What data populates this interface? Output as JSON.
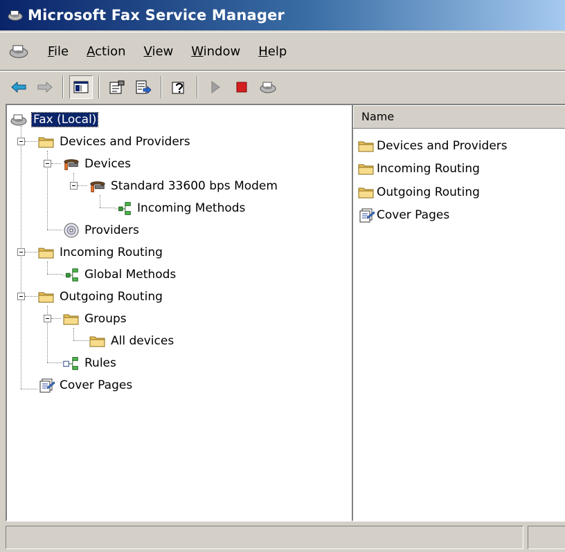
{
  "window": {
    "title": "Microsoft Fax Service Manager",
    "title_bar_colors": [
      "#0a246a",
      "#a6caf0"
    ]
  },
  "menu": {
    "items": [
      {
        "label": "File",
        "accel": "F"
      },
      {
        "label": "Action",
        "accel": "A"
      },
      {
        "label": "View",
        "accel": "V"
      },
      {
        "label": "Window",
        "accel": "W"
      },
      {
        "label": "Help",
        "accel": "H"
      }
    ]
  },
  "toolbar": {
    "buttons": [
      {
        "icon": "back-arrow-icon"
      },
      {
        "icon": "forward-arrow-icon"
      },
      {
        "icon": "show-hide-tree-icon",
        "pressed": true
      },
      {
        "icon": "properties-icon"
      },
      {
        "icon": "export-list-icon"
      },
      {
        "icon": "help-icon"
      },
      {
        "icon": "start-icon"
      },
      {
        "icon": "stop-icon"
      },
      {
        "icon": "fax-icon"
      }
    ]
  },
  "tree": {
    "root": "Fax (Local)",
    "devices_and_providers": "Devices and Providers",
    "devices": "Devices",
    "modem": "Standard 33600 bps Modem",
    "incoming_methods": "Incoming Methods",
    "providers": "Providers",
    "incoming_routing": "Incoming Routing",
    "global_methods": "Global Methods",
    "outgoing_routing": "Outgoing Routing",
    "groups": "Groups",
    "all_devices": "All devices",
    "rules": "Rules",
    "cover_pages": "Cover Pages"
  },
  "list": {
    "column_name": "Name",
    "items": [
      {
        "label": "Devices and Providers",
        "icon": "folder-icon"
      },
      {
        "label": "Incoming Routing",
        "icon": "folder-icon"
      },
      {
        "label": "Outgoing Routing",
        "icon": "folder-icon"
      },
      {
        "label": "Cover Pages",
        "icon": "cover-pages-icon"
      }
    ]
  },
  "status": {
    "text": ""
  }
}
